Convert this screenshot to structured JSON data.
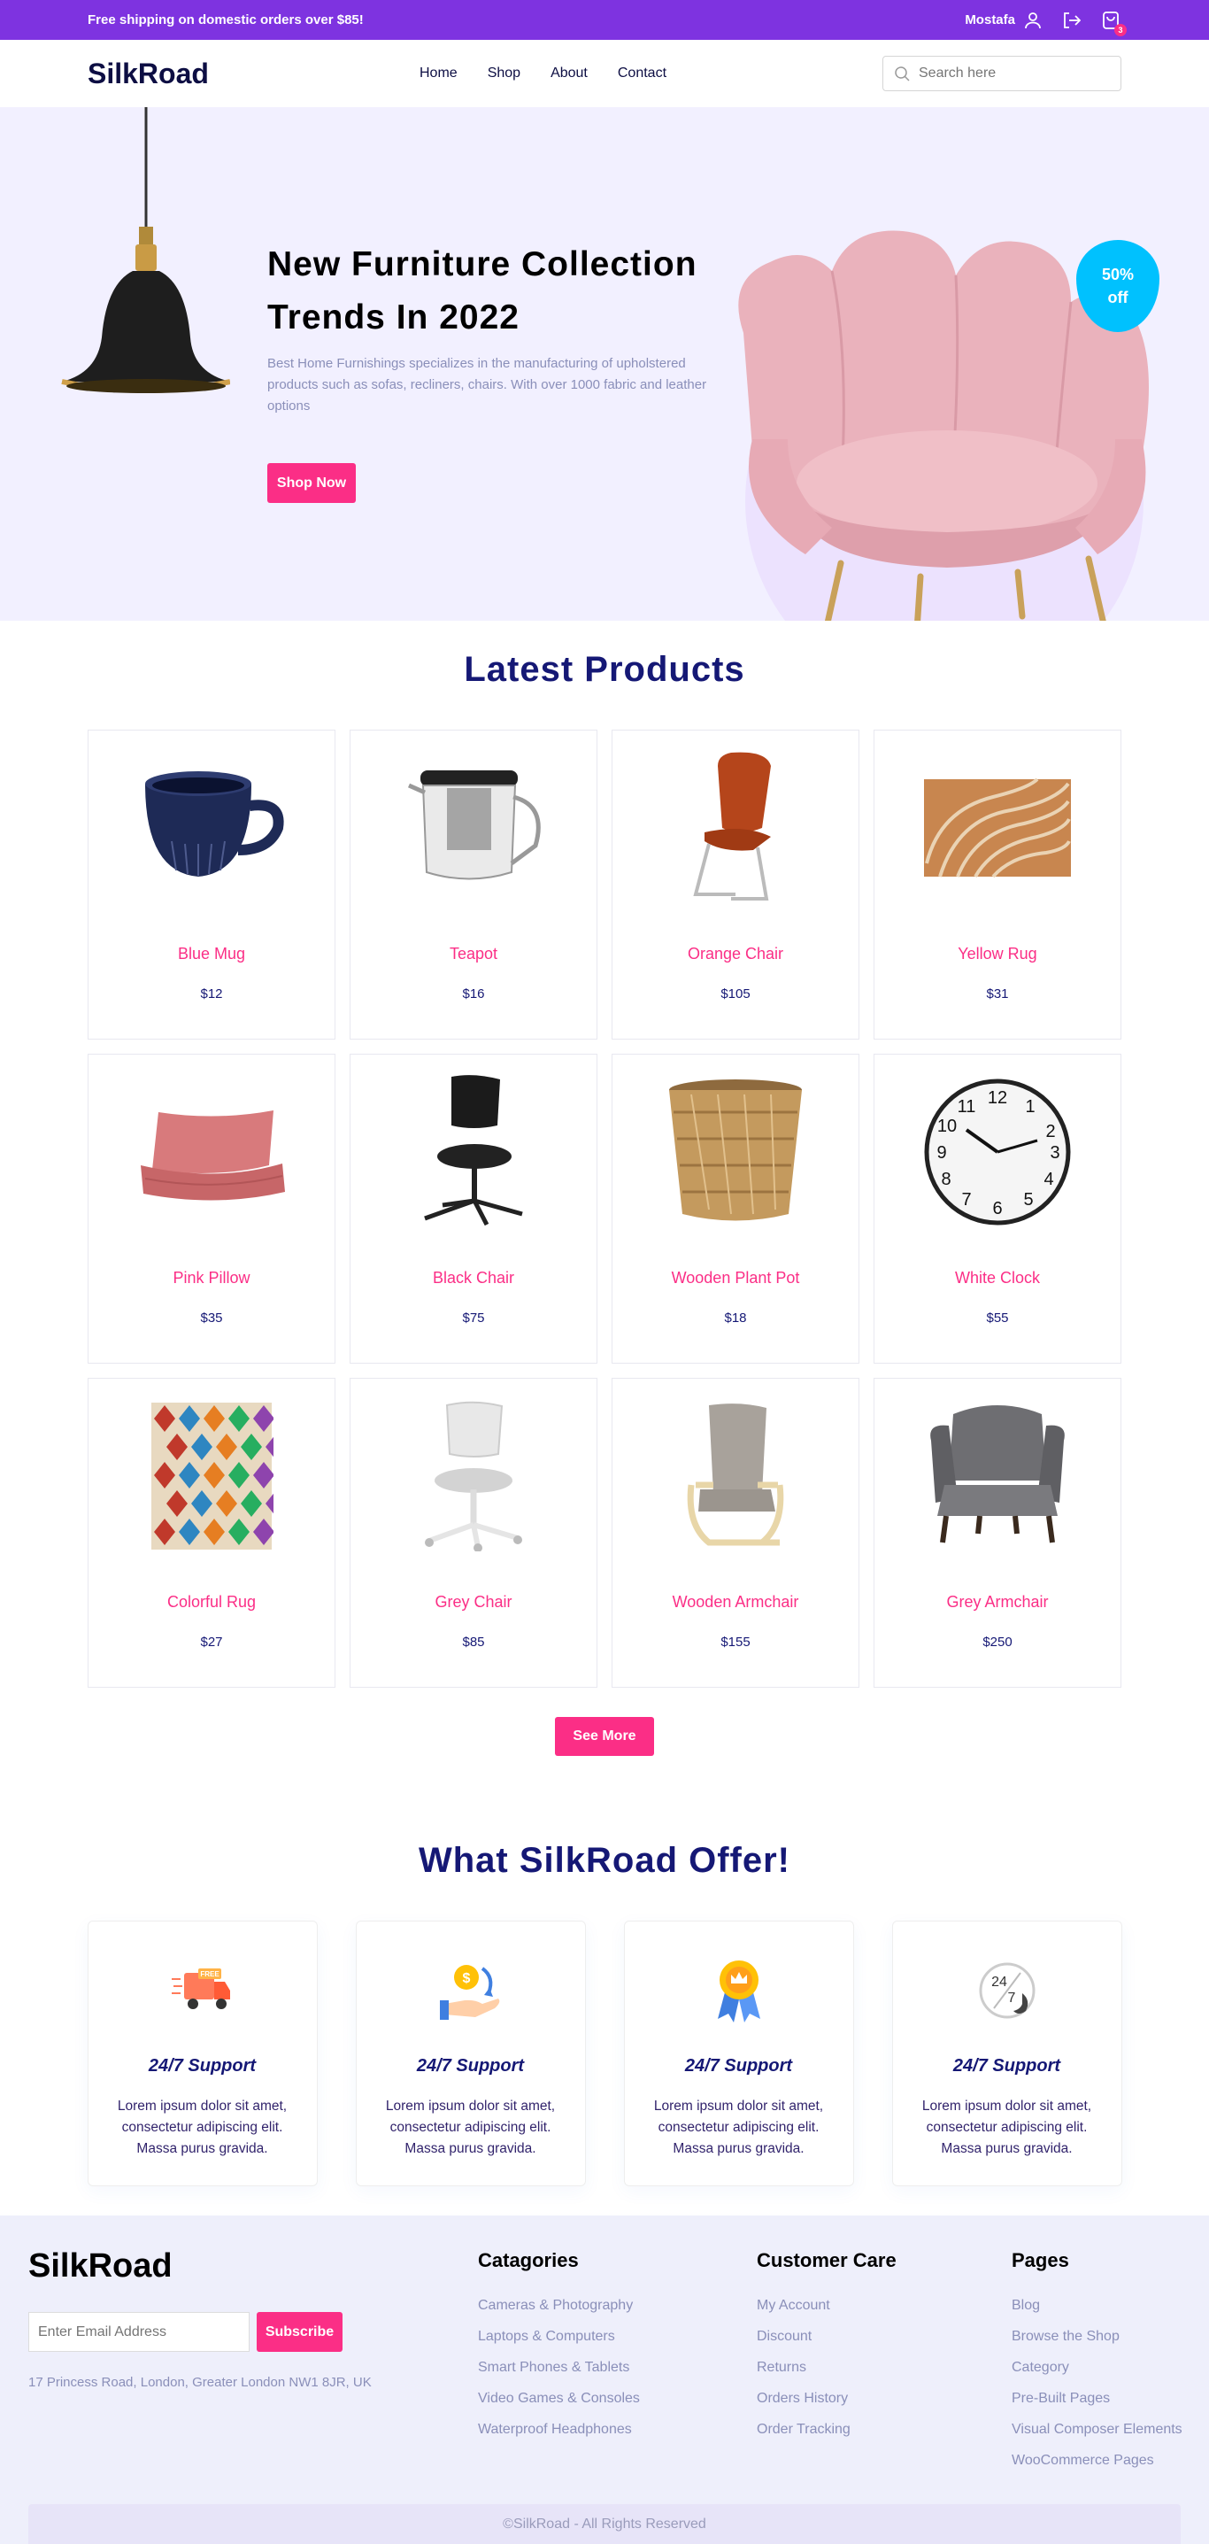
{
  "topbar": {
    "message": "Free shipping on domestic orders over $85!",
    "username": "Mostafa",
    "cart_count": "3"
  },
  "nav": {
    "logo": "SilkRoad",
    "links": [
      "Home",
      "Shop",
      "About",
      "Contact"
    ],
    "search_placeholder": "Search here"
  },
  "hero": {
    "title_line1": "New Furniture Collection",
    "title_line2": "Trends In 2022",
    "description": "Best Home Furnishings specializes in the manufacturing of upholstered products such as sofas, recliners, chairs. With over 1000 fabric and leather options",
    "cta": "Shop Now",
    "discount_line1": "50%",
    "discount_line2": "off"
  },
  "latest": {
    "title": "Latest Products",
    "products": [
      {
        "name": "Blue Mug",
        "price": "$12"
      },
      {
        "name": "Teapot",
        "price": "$16"
      },
      {
        "name": "Orange Chair",
        "price": "$105"
      },
      {
        "name": "Yellow Rug",
        "price": "$31"
      },
      {
        "name": "Pink Pillow",
        "price": "$35"
      },
      {
        "name": "Black Chair",
        "price": "$75"
      },
      {
        "name": "Wooden Plant Pot",
        "price": "$18"
      },
      {
        "name": "White Clock",
        "price": "$55"
      },
      {
        "name": "Colorful Rug",
        "price": "$27"
      },
      {
        "name": "Grey Chair",
        "price": "$85"
      },
      {
        "name": "Wooden Armchair",
        "price": "$155"
      },
      {
        "name": "Grey Armchair",
        "price": "$250"
      }
    ],
    "see_more": "See More"
  },
  "offer": {
    "title": "What SilkRoad Offer!",
    "cards": [
      {
        "icon": "free-delivery-icon",
        "title": "24/7 Support",
        "text": "Lorem ipsum dolor sit amet, consectetur adipiscing elit. Massa purus gravida.",
        "free_label": "FREE"
      },
      {
        "icon": "cashback-icon",
        "title": "24/7 Support",
        "text": "Lorem ipsum dolor sit amet, consectetur adipiscing elit. Massa purus gravida."
      },
      {
        "icon": "premium-quality-icon",
        "title": "24/7 Support",
        "text": "Lorem ipsum dolor sit amet, consectetur adipiscing elit. Massa purus gravida."
      },
      {
        "icon": "support-24-7-icon",
        "title": "24/7 Support",
        "text": "Lorem ipsum dolor sit amet, consectetur adipiscing elit. Massa purus gravida.",
        "icon_text_top": "24",
        "icon_text_bottom": "7"
      }
    ]
  },
  "footer": {
    "logo": "SilkRoad",
    "email_placeholder": "Enter Email Address",
    "subscribe": "Subscribe",
    "address": "17 Princess Road, London, Greater London NW1 8JR, UK",
    "columns": [
      {
        "title": "Catagories",
        "items": [
          "Cameras & Photography",
          "Laptops & Computers",
          "Smart Phones & Tablets",
          "Video Games & Consoles",
          "Waterproof Headphones"
        ]
      },
      {
        "title": "Customer Care",
        "items": [
          "My Account",
          "Discount",
          "Returns",
          "Orders History",
          "Order Tracking"
        ]
      },
      {
        "title": "Pages",
        "items": [
          "Blog",
          "Browse the Shop",
          "Category",
          "Pre-Built Pages",
          "Visual Composer Elements",
          "WooCommerce Pages"
        ]
      }
    ],
    "copyright": "©SilkRoad - All Rights Reserved"
  },
  "colors": {
    "accent": "#7e33e0",
    "pink": "#fb2e86",
    "navy": "#151875",
    "badge_blue": "#00c1fe",
    "hero_bg": "#f2f0ff"
  }
}
